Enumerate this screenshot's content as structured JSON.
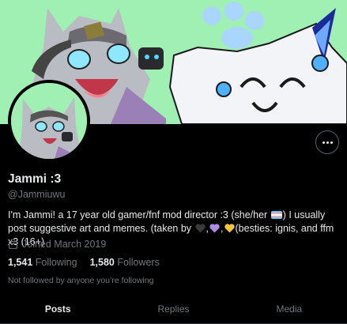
{
  "profile": {
    "display_name": "Jammi :3",
    "handle": "@Jammiuwu",
    "bio": {
      "part1": "I'm Jammi! a 17 year old gamer/fnf mod director :3 (she/her",
      "part2": ") I usually post suggestive art and memes. (taken by",
      "sep1": ",",
      "sep2": ",",
      "part3": "(besties: ignis, and ffm x3 (16+)"
    },
    "joined": "Joined March 2019",
    "following_count": "1,541",
    "following_label": "Following",
    "followers_count": "1,580",
    "followers_label": "Followers",
    "not_followed_note": "Not followed by anyone you’re following"
  },
  "tabs": [
    {
      "label": "Posts",
      "active": true
    },
    {
      "label": "Replies",
      "active": false
    },
    {
      "label": "Media",
      "active": false
    }
  ],
  "colors": {
    "background": "#000000",
    "banner_bg": "#9ff0b2",
    "text_primary": "#e7e9ea",
    "text_secondary": "#71767b",
    "heart_black": "#3a3a3a",
    "heart_purple": "#b08be6",
    "heart_yellow": "#f5c542"
  },
  "icons": {
    "more": "more-horizontal-icon",
    "calendar": "calendar-icon",
    "flag": "trans-flag-emoji",
    "hearts": [
      "black-heart-emoji",
      "purple-heart-emoji",
      "yellow-heart-emoji"
    ]
  }
}
